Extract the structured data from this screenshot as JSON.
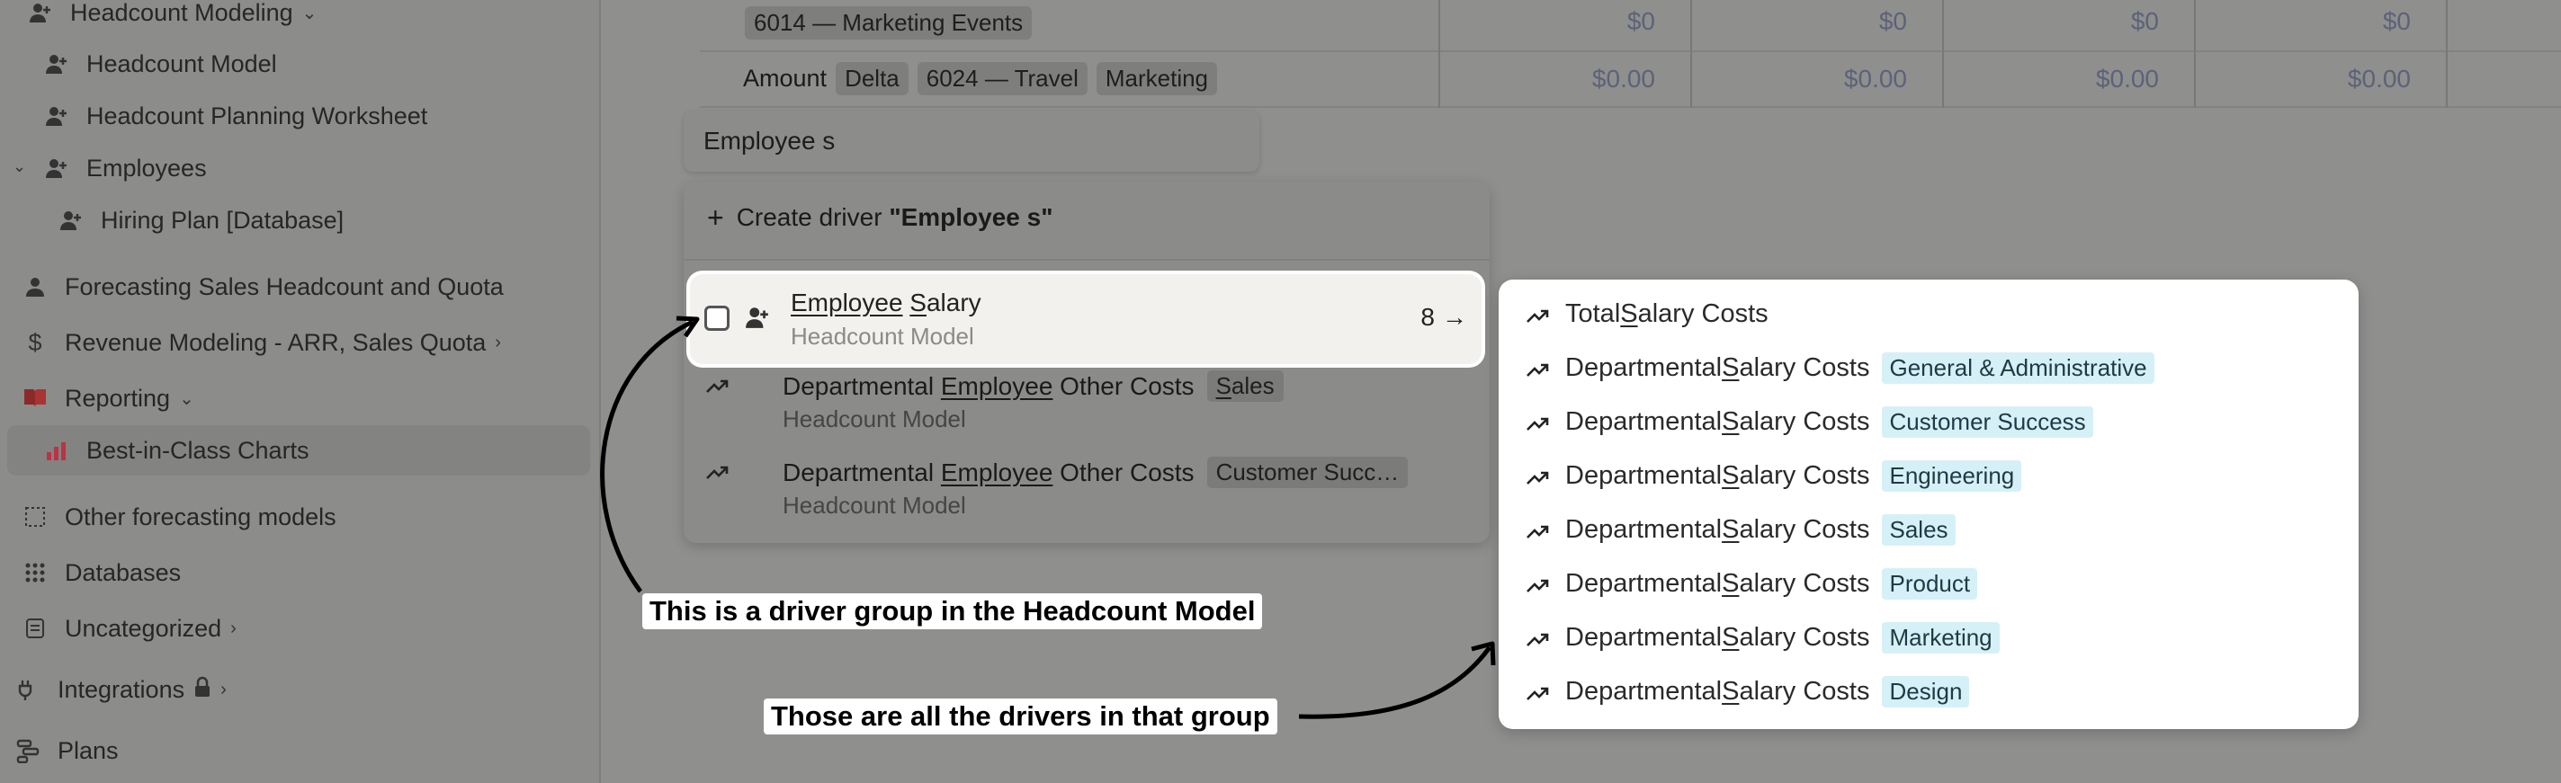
{
  "sidebar": {
    "items": [
      {
        "label": "Headcount Modeling",
        "icon": "person-plus-icon",
        "chevron": "⌄"
      },
      {
        "label": "Headcount Model",
        "icon": "person-plus-icon"
      },
      {
        "label": "Headcount Planning Worksheet",
        "icon": "person-plus-icon"
      },
      {
        "label": "Employees",
        "icon": "person-plus-icon"
      },
      {
        "label": "Hiring Plan [Database]",
        "icon": "person-plus-icon"
      },
      {
        "label": "Forecasting Sales Headcount and Quota",
        "icon": "person-icon"
      },
      {
        "label": "Revenue Modeling - ARR, Sales Quota",
        "icon": "dollar-icon",
        "chevron": "›"
      },
      {
        "label": "Reporting",
        "icon": "book-icon",
        "chevron": "⌄"
      },
      {
        "label": "Best-in-Class Charts",
        "icon": "bar-chart-icon"
      },
      {
        "label": "Other forecasting models",
        "icon": "dotted-square-icon"
      },
      {
        "label": "Databases",
        "icon": "grid-icon"
      },
      {
        "label": "Uncategorized",
        "icon": "document-icon",
        "chevron": "›"
      },
      {
        "label": "Integrations",
        "icon": "plug-icon",
        "chevron": "›"
      },
      {
        "label": "Plans",
        "icon": "plans-icon"
      }
    ]
  },
  "table": {
    "row1": {
      "chip": "6014 — Marketing Events",
      "values": [
        "$0",
        "$0",
        "$0",
        "$0"
      ]
    },
    "row2": {
      "label": "Amount",
      "chips": [
        "Delta",
        "6024 — Travel",
        "Marketing"
      ],
      "values": [
        "$0.00",
        "$0.00",
        "$0.00",
        "$0.00"
      ]
    }
  },
  "search": {
    "value": "Employee s"
  },
  "dropdown": {
    "create_prefix": "Create driver",
    "create_query": "\"Employee s\"",
    "selected": {
      "name_a": "Employee",
      "name_b": " Salary",
      "name_u2": "S",
      "name_rest": "alary",
      "subtitle": "Headcount Model",
      "count": "8"
    },
    "options": [
      {
        "pre": "Departmental ",
        "u": "Employee",
        "post": " Other Costs",
        "tag_u": "S",
        "tag_rest": "ales",
        "subtitle": "Headcount Model"
      },
      {
        "pre": "Departmental ",
        "u": "Employee",
        "post": " Other Costs",
        "tag_u": "",
        "tag_rest": "Customer Succ…",
        "subtitle": "Headcount Model"
      }
    ]
  },
  "drivers": {
    "items": [
      {
        "pre": "Total ",
        "u": "S",
        "post": "alary Costs",
        "tag": ""
      },
      {
        "pre": "Departmental ",
        "u": "S",
        "post": "alary Costs",
        "tag": "General & Administrative"
      },
      {
        "pre": "Departmental ",
        "u": "S",
        "post": "alary Costs",
        "tag": "Customer Success"
      },
      {
        "pre": "Departmental ",
        "u": "S",
        "post": "alary Costs",
        "tag": "Engineering"
      },
      {
        "pre": "Departmental ",
        "u": "S",
        "post": "alary Costs",
        "tag": "Sales"
      },
      {
        "pre": "Departmental ",
        "u": "S",
        "post": "alary Costs",
        "tag": "Product"
      },
      {
        "pre": "Departmental ",
        "u": "S",
        "post": "alary Costs",
        "tag": "Marketing"
      },
      {
        "pre": "Departmental ",
        "u": "S",
        "post": "alary Costs",
        "tag": "Design"
      }
    ]
  },
  "callouts": {
    "group": "This is a driver group in the Headcount Model",
    "drivers": "Those are all the drivers in that group"
  },
  "colors": {
    "tag_bg": "#d6f0f7",
    "panel_bg": "#ffffff",
    "overlay_bg": "#8f8f8e"
  }
}
